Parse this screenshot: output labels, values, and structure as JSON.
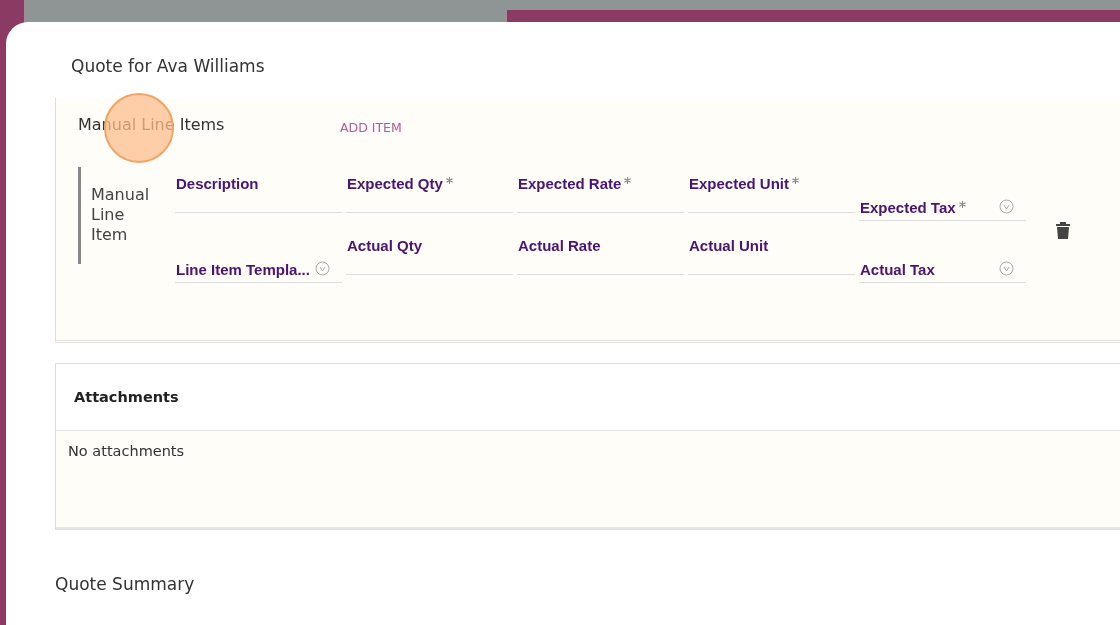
{
  "dialog": {
    "title": "Quote for Ava Williams"
  },
  "line_items": {
    "heading": "Manual Line Items",
    "add_button": "ADD ITEM",
    "items": [
      {
        "label": "Manual Line Item",
        "rows": [
          [
            {
              "kind": "text",
              "label": "Description",
              "required": false
            },
            {
              "kind": "text",
              "label": "Expected Qty",
              "required": true
            },
            {
              "kind": "text",
              "label": "Expected Rate",
              "required": true
            },
            {
              "kind": "text",
              "label": "Expected Unit",
              "required": true
            },
            {
              "kind": "select",
              "label": "Expected Tax",
              "required": true
            }
          ],
          [
            {
              "kind": "select",
              "label": "Line Item Templa...",
              "required": false
            },
            {
              "kind": "text",
              "label": "Actual Qty",
              "required": false
            },
            {
              "kind": "text",
              "label": "Actual Rate",
              "required": false
            },
            {
              "kind": "text",
              "label": "Actual Unit",
              "required": false
            },
            {
              "kind": "select",
              "label": "Actual Tax",
              "required": false
            }
          ]
        ]
      }
    ]
  },
  "attachments": {
    "heading": "Attachments",
    "empty_text": "No attachments"
  },
  "summary": {
    "heading": "Quote Summary"
  }
}
